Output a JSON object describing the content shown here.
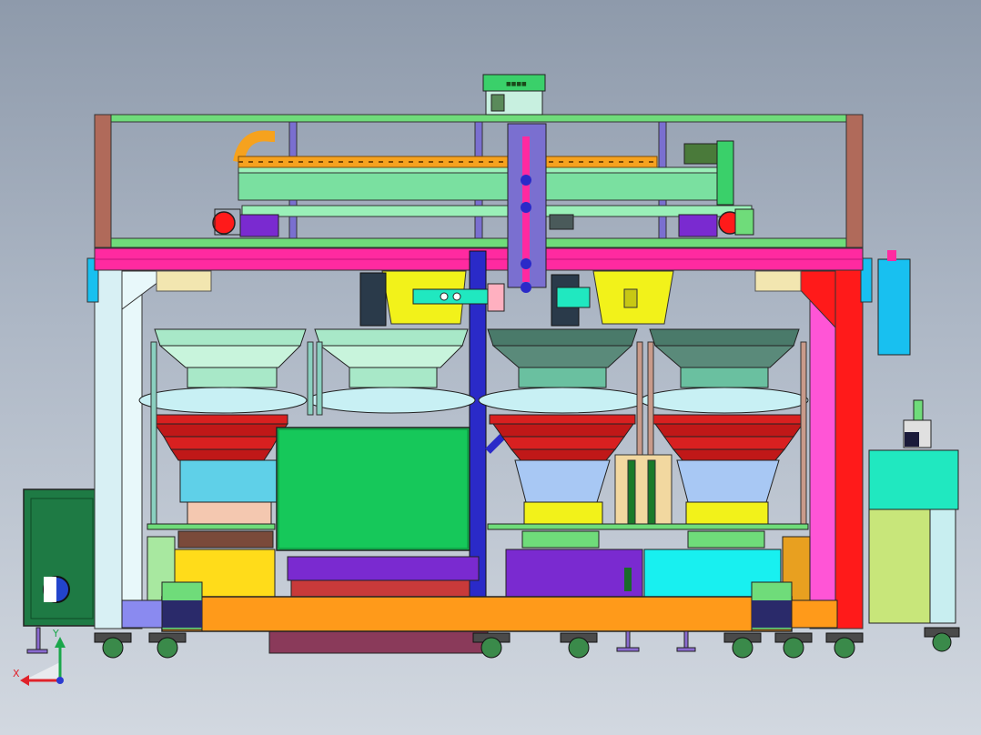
{
  "viewport": {
    "background_top": "#8e9aab",
    "background_bottom": "#d2d8e0"
  },
  "triad": {
    "x_label": "X",
    "y_label": "Y",
    "x_color": "#e0222a",
    "y_color": "#1aa64a",
    "z_color": "#2a3ad0"
  },
  "palette": {
    "frame_green": "#6fdc7a",
    "frame_magenta": "#ff2aa0",
    "frame_red": "#ff1a1a",
    "frame_light": "#d8f0f4",
    "base_orange": "#ff9a1a",
    "bowl_red": "#d82020",
    "bowl_cyan": "#5fd0e8",
    "bowl_yellow": "#f2f21a",
    "hopper_green": "#a8e8c8",
    "hopper_dark": "#4a7a6a",
    "cabinet_green": "#1e7a44",
    "box_green": "#16c85a",
    "purple": "#7a2ad0",
    "navy": "#2a2ac8",
    "cyan": "#18c0f0",
    "chain_orange": "#f6a21e",
    "teal": "#20e8c0"
  }
}
